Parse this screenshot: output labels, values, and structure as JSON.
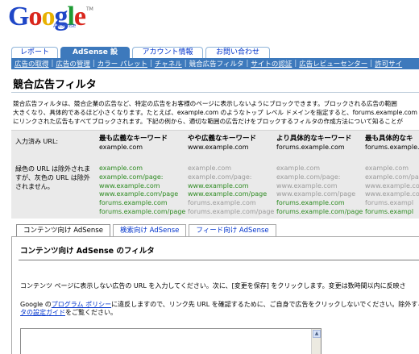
{
  "logo": {
    "text": "Google",
    "subtitle": "AdSense",
    "tm": "TM"
  },
  "main_tabs": [
    {
      "label": "レポート"
    },
    {
      "label": "AdSense 設定"
    },
    {
      "label": "アカウント情報"
    },
    {
      "label": "お問い合わせ"
    }
  ],
  "sub_nav": [
    {
      "label": "広告の取得"
    },
    {
      "label": "広告の管理"
    },
    {
      "label": "カラー パレット"
    },
    {
      "label": "チャネル"
    },
    {
      "label": "競合広告フィルタ"
    },
    {
      "label": "サイトの認証"
    },
    {
      "label": "広告レビューセンター"
    },
    {
      "label": "許可サイ"
    }
  ],
  "page_title": "競合広告フィルタ",
  "description": [
    "競合広告フィルタは、競合企業の広告など、特定の広告をお客様のページに表示しないようにブロックできます。ブロックされる広告の範囲",
    "大きくなり、具体的であるほど小さくなります。たとえば、example.com のようなトップ レベル ドメインを指定すると、forums.example.com",
    "にリンクされた広告もすべてブロックされます。下記の例から、適切な範囲の広告だけをブロックするフィルタの作成方法について知ることが"
  ],
  "example_table": {
    "input_label": "入力済み URL:",
    "note": "緑色の URL は除外されますが、灰色の URL は除外されません。",
    "columns": [
      {
        "header": "最も広義なキーワード",
        "sample": "example.com",
        "urls": [
          {
            "url": "example.com",
            "excluded": true
          },
          {
            "url": "example.com/page:",
            "excluded": true
          },
          {
            "url": "www.example.com",
            "excluded": true
          },
          {
            "url": "www.example.com/page",
            "excluded": true
          },
          {
            "url": "forums.example.com",
            "excluded": true
          },
          {
            "url": "forums.example.com/page",
            "excluded": true
          }
        ]
      },
      {
        "header": "やや広義なキーワード",
        "sample": "www.example.com",
        "urls": [
          {
            "url": "example.com",
            "excluded": false
          },
          {
            "url": "example.com/page:",
            "excluded": false
          },
          {
            "url": "www.example.com",
            "excluded": true
          },
          {
            "url": "www.example.com/page",
            "excluded": true
          },
          {
            "url": "forums.example.com",
            "excluded": false
          },
          {
            "url": "forums.example.com/page",
            "excluded": false
          }
        ]
      },
      {
        "header": "より具体的なキーワード",
        "sample": "forums.example.com",
        "urls": [
          {
            "url": "example.com",
            "excluded": false
          },
          {
            "url": "example.com/page:",
            "excluded": false
          },
          {
            "url": "www.example.com",
            "excluded": false
          },
          {
            "url": "www.example.com/page",
            "excluded": false
          },
          {
            "url": "forums.example.com",
            "excluded": true
          },
          {
            "url": "forums.example.com/page",
            "excluded": true
          }
        ]
      },
      {
        "header": "最も具体的なキ",
        "sample": "forums.example.c",
        "urls": [
          {
            "url": "example.com",
            "excluded": false
          },
          {
            "url": "example.com/pag",
            "excluded": false
          },
          {
            "url": "www.example.co",
            "excluded": false
          },
          {
            "url": "www.example.co",
            "excluded": false
          },
          {
            "url": "forums.exampl",
            "excluded": false
          },
          {
            "url": "forums.exampl",
            "excluded": true
          }
        ]
      }
    ]
  },
  "filter_tabs": [
    {
      "label": "コンテンツ向け AdSense",
      "active": true
    },
    {
      "label": "検索向け AdSense",
      "active": false
    },
    {
      "label": "フィード向け AdSense",
      "active": false
    }
  ],
  "panel": {
    "title": "コンテンツ向け AdSense のフィルタ",
    "instructions": "コンテンツ ページに表示しない広告の URL を入力してください。次に、[変更を保存] をクリックします。変更は数時間以内に反映さ",
    "policy_prefix": "Google の",
    "policy_link": "プログラム ポリシー",
    "policy_rest": "に違反しますので、リンク先 URL を確認するために、ご自身で広告をクリックしないでください。除外するU",
    "policy_link2": "タの設定ガイド",
    "policy_end": "をご覧ください。"
  },
  "colors": {
    "accent": "#3d79bc",
    "link": "#0033cc",
    "excluded_url": "#2e8b22",
    "not_excluded_url": "#9b9b9b",
    "table_bg": "#eaeaea"
  }
}
